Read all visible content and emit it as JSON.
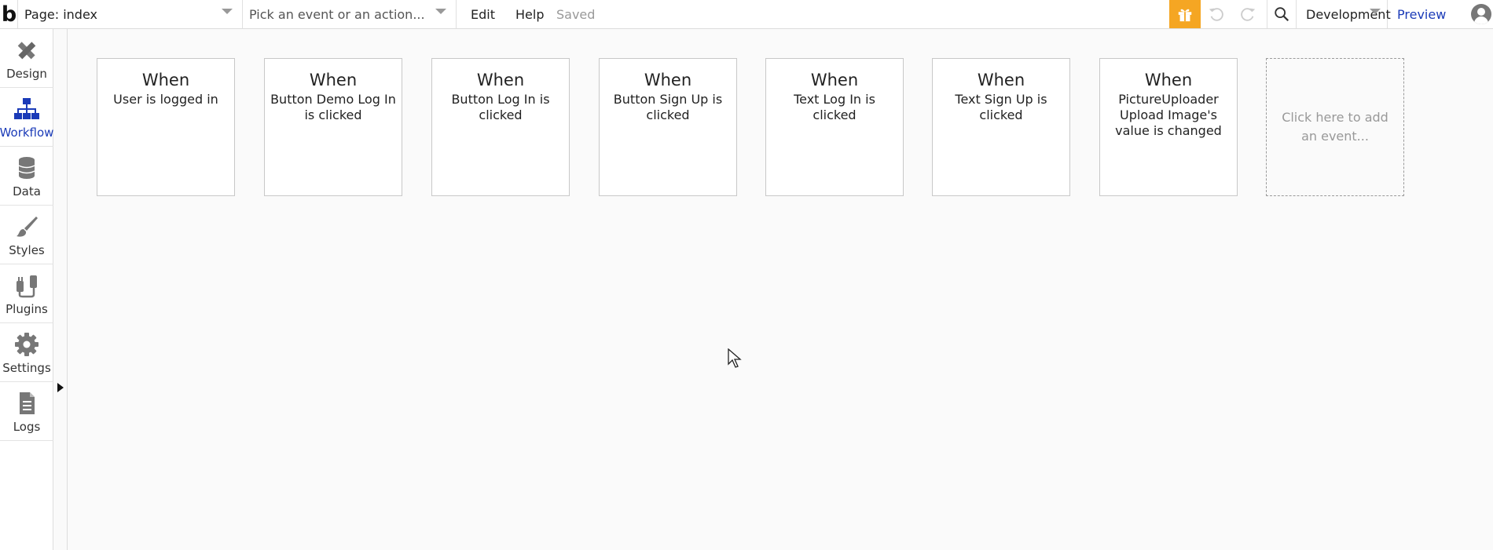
{
  "topbar": {
    "page_label": "Page: index",
    "event_placeholder": "Pick an event or an action...",
    "edit_label": "Edit",
    "help_label": "Help",
    "status": "Saved",
    "environment": "Development",
    "preview_label": "Preview",
    "accent_color": "#f5a623",
    "link_color": "#1b3bb8"
  },
  "sidebar": {
    "items": [
      {
        "label": "Design",
        "icon": "pencil-ruler-icon"
      },
      {
        "label": "Workflow",
        "icon": "workflow-icon",
        "active": true
      },
      {
        "label": "Data",
        "icon": "database-icon"
      },
      {
        "label": "Styles",
        "icon": "brush-icon"
      },
      {
        "label": "Plugins",
        "icon": "plug-icon"
      },
      {
        "label": "Settings",
        "icon": "gear-icon"
      },
      {
        "label": "Logs",
        "icon": "document-icon"
      }
    ]
  },
  "events": [
    {
      "title": "When",
      "description": "User is logged in"
    },
    {
      "title": "When",
      "description": "Button Demo Log In is clicked"
    },
    {
      "title": "When",
      "description": "Button Log In is clicked"
    },
    {
      "title": "When",
      "description": "Button Sign Up is clicked"
    },
    {
      "title": "When",
      "description": "Text Log In is clicked"
    },
    {
      "title": "When",
      "description": "Text Sign Up is clicked"
    },
    {
      "title": "When",
      "description": "PictureUploader Upload Image's value is changed"
    }
  ],
  "add_event_label": "Click here to add an event..."
}
